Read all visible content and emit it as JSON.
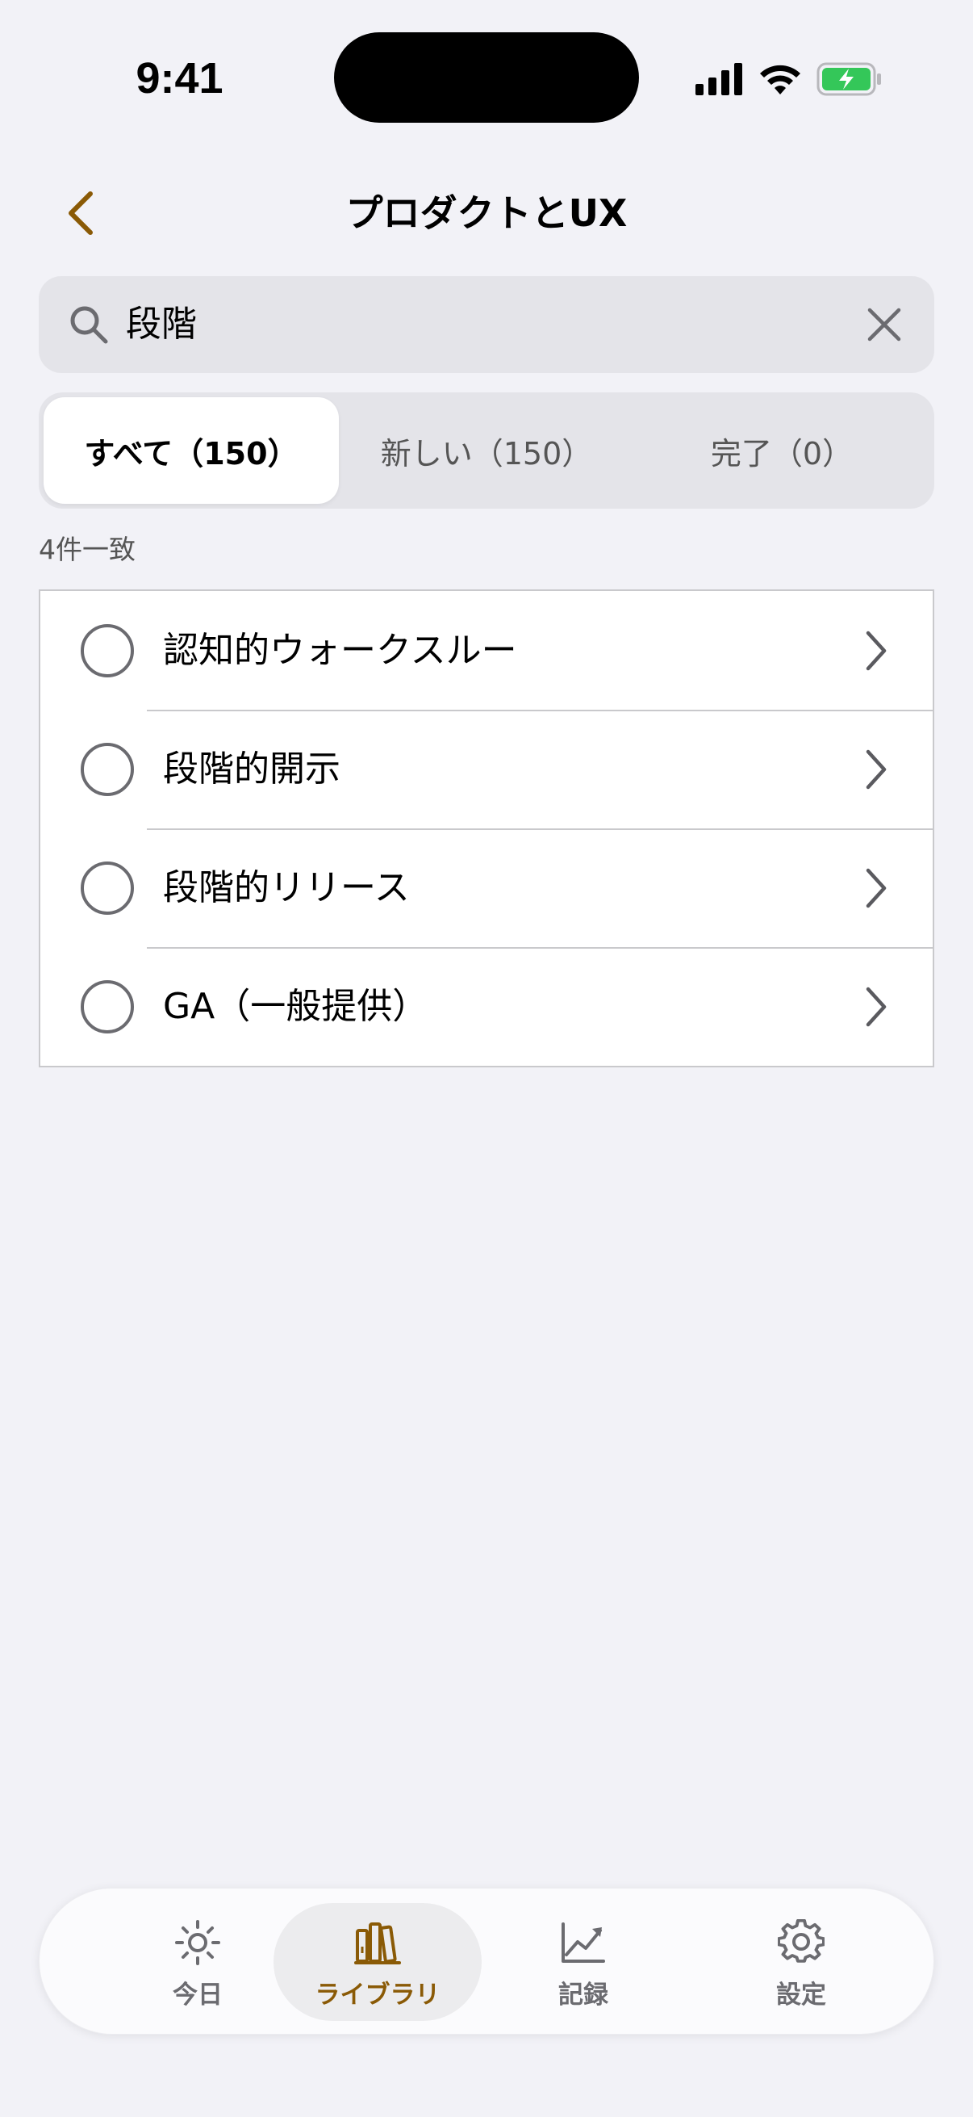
{
  "status_bar": {
    "time": "9:41"
  },
  "nav": {
    "title": "プロダクトとUX"
  },
  "search": {
    "value": "段階",
    "placeholder": ""
  },
  "segments": [
    {
      "label": "すべて（150）"
    },
    {
      "label": "新しい（150）"
    },
    {
      "label": "完了（0）"
    }
  ],
  "match_count": "4件一致",
  "items": [
    {
      "label": "認知的ウォークスルー"
    },
    {
      "label": "段階的開示"
    },
    {
      "label": "段階的リリース"
    },
    {
      "label": "GA（一般提供）"
    }
  ],
  "tabbar": [
    {
      "label": "今日",
      "icon": "sun-icon"
    },
    {
      "label": "ライブラリ",
      "icon": "books-icon"
    },
    {
      "label": "記録",
      "icon": "chart-icon"
    },
    {
      "label": "設定",
      "icon": "gear-icon"
    }
  ],
  "colors": {
    "accent": "#8a5a06",
    "background": "#f2f2f7",
    "battery": "#34c759"
  }
}
